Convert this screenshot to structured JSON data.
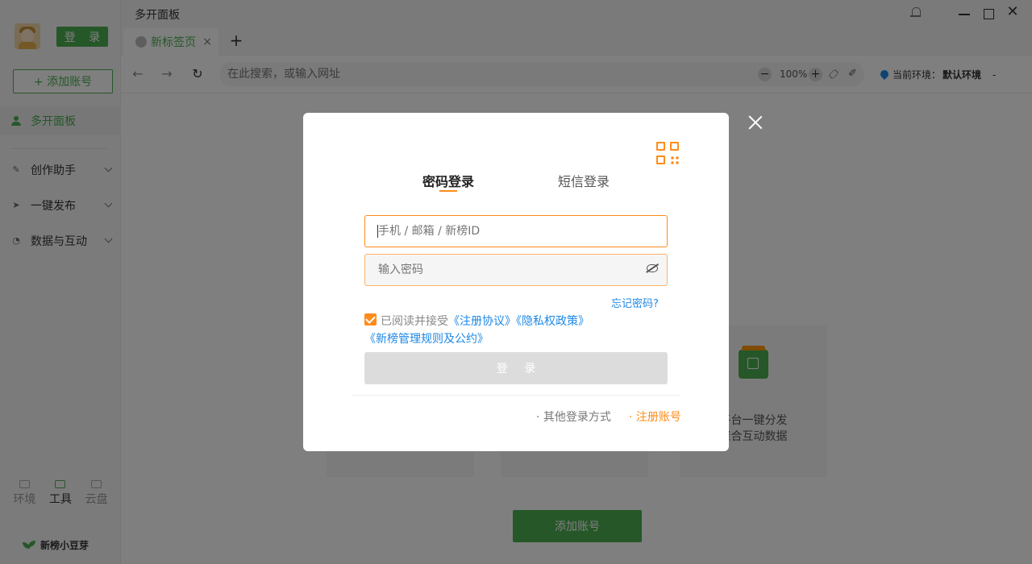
{
  "sidebar": {
    "login_label": "登 录",
    "add_account_label": "+ 添加账号",
    "nav_active": "多开面板",
    "nav_items": [
      {
        "label": "创作助手",
        "icon": "pen-icon"
      },
      {
        "label": "一键发布",
        "icon": "send-icon"
      },
      {
        "label": "数据与互动",
        "icon": "pie-chart-icon"
      }
    ],
    "bottom_tabs": [
      {
        "label": "环境",
        "icon": "monitor-icon"
      },
      {
        "label": "工具",
        "icon": "toolbox-icon"
      },
      {
        "label": "云盘",
        "icon": "folder-icon"
      }
    ],
    "brand": "新榜小豆芽"
  },
  "titlebar": {
    "title": "多开面板"
  },
  "tabs": {
    "current_tab": "新标签页",
    "close": "×",
    "new_tab": "+"
  },
  "navbar": {
    "address_placeholder": "在此搜索，或输入网址",
    "zoom_out": "−",
    "zoom": "100%",
    "zoom_in": "+",
    "env_label": "当前环境：",
    "env_value": "默认环境",
    "env_dash": "-"
  },
  "content": {
    "card_text_1": "平台一键分发",
    "card_text_2": "聚合互动数据",
    "add_account": "添加账号"
  },
  "modal": {
    "tab_password": "密码登录",
    "tab_sms": "短信登录",
    "user_placeholder": "手机 / 邮箱 / 新榜ID",
    "password_placeholder": "输入密码",
    "forgot": "忘记密码?",
    "agree_prefix": "已阅读并接受",
    "link_terms": "《注册协议》",
    "link_privacy": "《隐私权政策》",
    "link_rules": "《新榜管理规则及公约》",
    "submit": "登 录",
    "other_login": "· 其他登录方式",
    "register": "· 注册账号"
  },
  "colors": {
    "brand_green": "#4caf50",
    "accent_orange": "#ff8c1a",
    "link_blue": "#1e88e5"
  }
}
